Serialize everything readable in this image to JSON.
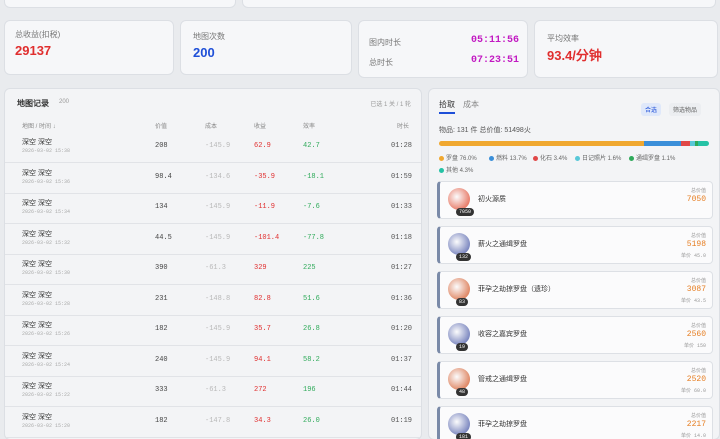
{
  "stats": {
    "income_label": "总收益(扣税)",
    "income_value": "29137",
    "maps_label": "地图次数",
    "maps_value": "200",
    "in_map_label": "图内时长",
    "in_map_value": "05:11:56",
    "total_label": "总时长",
    "total_value": "07:23:51",
    "eff_label": "平均效率",
    "eff_value": "93.4/分钟"
  },
  "records": {
    "title": "地图记录",
    "count": "200",
    "selected": "已选 1 关 / 1 轮",
    "headers": {
      "map": "地图 / 时间 ↓",
      "value": "价值",
      "cost": "成本",
      "income": "收益",
      "eff": "效率",
      "time": "时长"
    },
    "rows": [
      {
        "name": "深空 深空",
        "date": "2026-03-02 15:38",
        "value": "208",
        "cost": "-145.9",
        "income": "62.9",
        "eff": "42.7",
        "time": "01:28"
      },
      {
        "name": "深空 深空",
        "date": "2026-03-02 15:36",
        "value": "98.4",
        "cost": "-134.6",
        "income": "-35.9",
        "eff": "-18.1",
        "time": "01:59"
      },
      {
        "name": "深空 深空",
        "date": "2026-03-02 15:34",
        "value": "134",
        "cost": "-145.9",
        "income": "-11.9",
        "eff": "-7.6",
        "time": "01:33"
      },
      {
        "name": "深空 深空",
        "date": "2026-03-02 15:32",
        "value": "44.5",
        "cost": "-145.9",
        "income": "-101.4",
        "eff": "-77.8",
        "time": "01:18"
      },
      {
        "name": "深空 深空",
        "date": "2026-03-02 15:30",
        "value": "390",
        "cost": "-61.3",
        "income": "329",
        "eff": "225",
        "time": "01:27"
      },
      {
        "name": "深空 深空",
        "date": "2026-03-02 15:28",
        "value": "231",
        "cost": "-148.8",
        "income": "82.8",
        "eff": "51.6",
        "time": "01:36"
      },
      {
        "name": "深空 深空",
        "date": "2026-03-02 15:26",
        "value": "182",
        "cost": "-145.9",
        "income": "35.7",
        "eff": "26.8",
        "time": "01:20"
      },
      {
        "name": "深空 深空",
        "date": "2026-03-02 15:24",
        "value": "240",
        "cost": "-145.9",
        "income": "94.1",
        "eff": "58.2",
        "time": "01:37"
      },
      {
        "name": "深空 深空",
        "date": "2026-03-02 15:22",
        "value": "333",
        "cost": "-61.3",
        "income": "272",
        "eff": "196",
        "time": "01:44"
      },
      {
        "name": "深空 深空",
        "date": "2026-03-02 15:20",
        "value": "182",
        "cost": "-147.8",
        "income": "34.3",
        "eff": "26.0",
        "time": "01:19"
      }
    ]
  },
  "loot": {
    "tab_pickup": "拾取",
    "tab_cost": "成本",
    "btn_all": "合选",
    "btn_filter": "筛选物品",
    "summary": "物品: 131 件   总价值: 51498火",
    "legend": [
      {
        "label": "罗盘 76.0%",
        "color": "#f0a830"
      },
      {
        "label": "燃料 13.7%",
        "color": "#3b8fd9"
      },
      {
        "label": "化石 3.4%",
        "color": "#e04848"
      },
      {
        "label": "日记照片 1.6%",
        "color": "#58c8d8"
      },
      {
        "label": "通缉罗盘 1.1%",
        "color": "#2faa5a"
      },
      {
        "label": "其他 4.3%",
        "color": "#25c2a5"
      }
    ],
    "items": [
      {
        "name": "初火源质",
        "badge": "7050",
        "r1": "总价值",
        "r2": "7050",
        "r3": "",
        "icon_color": "#e04a2f"
      },
      {
        "name": "薪火之通缉罗盘",
        "badge": "132",
        "r1": "总价值",
        "r2": "5198",
        "r3": "单价 45.0",
        "icon_color": "#4a5aa8"
      },
      {
        "name": "菲孕之劫掠罗盘（遗珍）",
        "badge": "83",
        "r1": "总价值",
        "r2": "3087",
        "r3": "单价 43.5",
        "icon_color": "#d45a2a"
      },
      {
        "name": "收容之嘉宾罗盘",
        "badge": "19",
        "r1": "总价值",
        "r2": "2560",
        "r3": "单价 150",
        "icon_color": "#4a5aa8"
      },
      {
        "name": "管戒之通缉罗盘",
        "badge": "48",
        "r1": "总价值",
        "r2": "2520",
        "r3": "单价 60.0",
        "icon_color": "#d45a2a"
      },
      {
        "name": "菲孕之劫掠罗盘",
        "badge": "181",
        "r1": "总价值",
        "r2": "2217",
        "r3": "单价 14.0",
        "icon_color": "#4a5aa8"
      }
    ]
  },
  "colors": {
    "pos": "#e02e2e",
    "neg_eff": "#2faa5a",
    "accent": "#1e4fd8",
    "purple": "#c21ac2",
    "orange": "#e67e22"
  }
}
